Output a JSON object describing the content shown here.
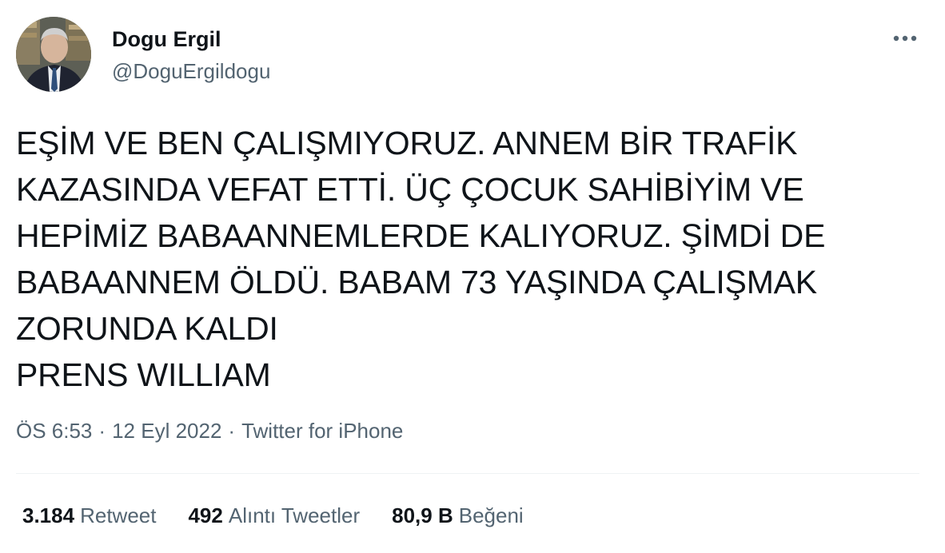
{
  "author": {
    "display_name": "Dogu Ergil",
    "handle": "@DoguErgildogu"
  },
  "more_icon": "ellipsis-icon",
  "tweet": {
    "text": "EŞİM VE BEN ÇALIŞMIYORUZ. ANNEM BİR TRAFİK\nKAZASINDA VEFAT ETTİ. ÜÇ ÇOCUK SAHİBİYİM VE\nHEPİMİZ BABAANNEMLERDE KALIYORUZ. ŞİMDİ DE\nBABAANNEM ÖLDÜ. BABAM 73 YAŞINDA ÇALIŞMAK\nZORUNDA KALDI\nPRENS WILLIAM"
  },
  "meta": {
    "time": "ÖS 6:53",
    "date": "12 Eyl 2022",
    "separator": "·",
    "source": "Twitter for iPhone"
  },
  "stats": [
    {
      "count": "3.184",
      "label": "Retweet"
    },
    {
      "count": "492",
      "label": "Alıntı Tweetler"
    },
    {
      "count": "80,9 B",
      "label": "Beğeni"
    }
  ],
  "colors": {
    "text": "#0f1419",
    "secondary": "#536471",
    "divider": "#eff3f4"
  }
}
